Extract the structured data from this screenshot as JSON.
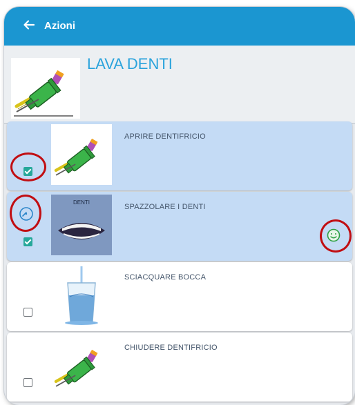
{
  "appbar": {
    "title": "Azioni"
  },
  "activity": {
    "title": "LAVA DENTI"
  },
  "steps": [
    {
      "label": "APRIRE DENTIFRICIO",
      "checked": true,
      "selected": true,
      "image": "toothpaste-toothbrush"
    },
    {
      "label": "SPAZZOLARE I DENTI",
      "checked": true,
      "selected": true,
      "image": "teeth-mouth",
      "image_caption": "DENTI"
    },
    {
      "label": "SCIACQUARE BOCCA",
      "checked": false,
      "selected": false,
      "image": "water-glass"
    },
    {
      "label": "CHIUDERE DENTIFRICIO",
      "checked": false,
      "selected": false,
      "image": "toothpaste-toothbrush"
    }
  ],
  "colors": {
    "appbar": "#1b96d1",
    "accent_title": "#2aa3dc",
    "selected_row": "#c4dbf5",
    "checkbox_on": "#26a89a",
    "highlight_ring": "#c10e12"
  },
  "icons": {
    "back": "arrow-left-icon",
    "timer": "timer-icon",
    "smiley": "smiley-icon"
  }
}
